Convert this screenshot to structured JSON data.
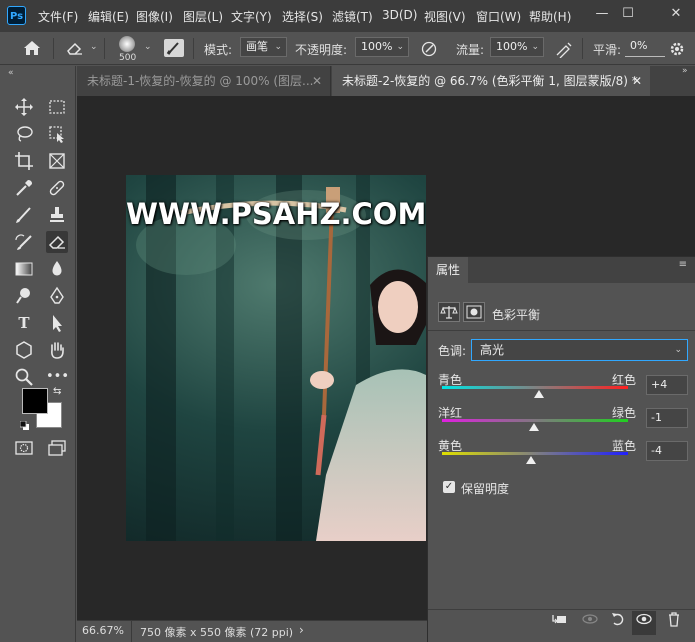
{
  "app": {
    "logo_text": "Ps",
    "menu": [
      "文件(F)",
      "编辑(E)",
      "图像(I)",
      "图层(L)",
      "文字(Y)",
      "选择(S)",
      "滤镜(T)",
      "3D(D)",
      "视图(V)",
      "窗口(W)",
      "帮助(H)"
    ],
    "window_controls": {
      "minimize": "—",
      "maximize": "☐",
      "close": "✕"
    }
  },
  "options_bar": {
    "brush_size": "500",
    "mode_label": "模式:",
    "mode_value": "画笔",
    "opacity_label": "不透明度:",
    "opacity_value": "100%",
    "flow_label": "流量:",
    "flow_value": "100%",
    "smoothing_label": "平滑:",
    "smoothing_value": "0%"
  },
  "tabs": [
    {
      "title": "未标题-1-恢复的-恢复的 @ 100% (图层...",
      "active": false
    },
    {
      "title": "未标题-2-恢复的 @ 66.7% (色彩平衡 1, 图层蒙版/8) *",
      "active": true
    }
  ],
  "canvas": {
    "watermark": "WWW.PSAHZ.COM"
  },
  "status": {
    "zoom": "66.67%",
    "doc_info": "750 像素 x 550 像素 (72 ppi)",
    "arrow": "›"
  },
  "properties": {
    "tab_label": "属性",
    "adjustment_name": "色彩平衡",
    "tone_label": "色调:",
    "tone_value": "高光",
    "sliders": [
      {
        "left": "青色",
        "right": "红色",
        "value": "+4",
        "numeric": 4
      },
      {
        "left": "洋红",
        "right": "绿色",
        "value": "-1",
        "numeric": -1
      },
      {
        "left": "黄色",
        "right": "蓝色",
        "value": "-4",
        "numeric": -4
      }
    ],
    "preserve_luminosity_label": "保留明度",
    "preserve_luminosity_checked": true
  },
  "tool_colors": {
    "foreground": "#000000",
    "background": "#ffffff"
  },
  "colors": {
    "accent": "#31a8ff",
    "panel": "#535353",
    "canvas_bg": "#282828"
  }
}
